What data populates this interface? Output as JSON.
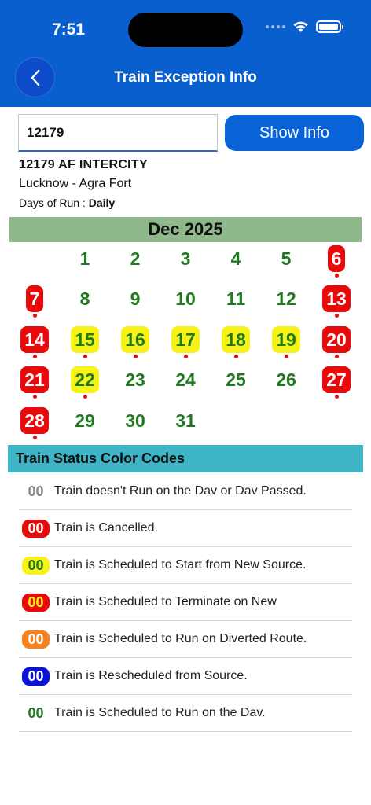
{
  "status_bar": {
    "time": "7:51"
  },
  "header": {
    "title": "Train Exception Info"
  },
  "search": {
    "value": "12179",
    "button_label": "Show Info"
  },
  "train": {
    "number_name": "12179  AF INTERCITY",
    "route": "Lucknow - Agra Fort",
    "days_label": "Days of Run : ",
    "days_value": "Daily"
  },
  "calendar": {
    "month": "Dec 2025",
    "first_weekday_index": 1,
    "days": [
      {
        "d": "1",
        "status": "normal"
      },
      {
        "d": "2",
        "status": "normal"
      },
      {
        "d": "3",
        "status": "normal"
      },
      {
        "d": "4",
        "status": "normal"
      },
      {
        "d": "5",
        "status": "normal"
      },
      {
        "d": "6",
        "status": "cancelled"
      },
      {
        "d": "7",
        "status": "cancelled"
      },
      {
        "d": "8",
        "status": "normal"
      },
      {
        "d": "9",
        "status": "normal"
      },
      {
        "d": "10",
        "status": "normal"
      },
      {
        "d": "11",
        "status": "normal"
      },
      {
        "d": "12",
        "status": "normal"
      },
      {
        "d": "13",
        "status": "cancelled"
      },
      {
        "d": "14",
        "status": "cancelled"
      },
      {
        "d": "15",
        "status": "new_source"
      },
      {
        "d": "16",
        "status": "new_source"
      },
      {
        "d": "17",
        "status": "new_source"
      },
      {
        "d": "18",
        "status": "new_source"
      },
      {
        "d": "19",
        "status": "new_source"
      },
      {
        "d": "20",
        "status": "cancelled"
      },
      {
        "d": "21",
        "status": "cancelled"
      },
      {
        "d": "22",
        "status": "new_source"
      },
      {
        "d": "23",
        "status": "normal"
      },
      {
        "d": "24",
        "status": "normal"
      },
      {
        "d": "25",
        "status": "normal"
      },
      {
        "d": "26",
        "status": "normal"
      },
      {
        "d": "27",
        "status": "cancelled"
      },
      {
        "d": "28",
        "status": "cancelled"
      },
      {
        "d": "29",
        "status": "normal"
      },
      {
        "d": "30",
        "status": "normal"
      },
      {
        "d": "31",
        "status": "normal"
      }
    ]
  },
  "legend": {
    "title": "Train Status Color Codes",
    "items": [
      {
        "badge": "00",
        "style": "gray",
        "text": "Train doesn't Run on the Dav or Dav Passed."
      },
      {
        "badge": "00",
        "style": "red",
        "text": "Train is Cancelled."
      },
      {
        "badge": "00",
        "style": "yellow",
        "text": "Train is Scheduled to Start from New Source."
      },
      {
        "badge": "00",
        "style": "redyellow",
        "text": "Train is Scheduled to Terminate on New"
      },
      {
        "badge": "00",
        "style": "orange",
        "text": "Train is Scheduled to Run on Diverted Route."
      },
      {
        "badge": "00",
        "style": "blue",
        "text": "Train is Rescheduled from Source."
      },
      {
        "badge": "00",
        "style": "green",
        "text": "Train is Scheduled to Run on the Dav."
      }
    ]
  },
  "colors": {
    "header_bg": "#0a5fcf",
    "month_bar": "#8fb98d",
    "legend_header": "#3fb4c6",
    "running_green": "#1f7a1f",
    "cancelled_red": "#e8090b",
    "new_source_yellow": "#f7f317",
    "diverted_orange": "#f4831f",
    "rescheduled_blue": "#0a14d8"
  },
  "icons": [
    "back-chevron-icon",
    "wifi-icon",
    "battery-icon",
    "signal-dots-icon"
  ]
}
